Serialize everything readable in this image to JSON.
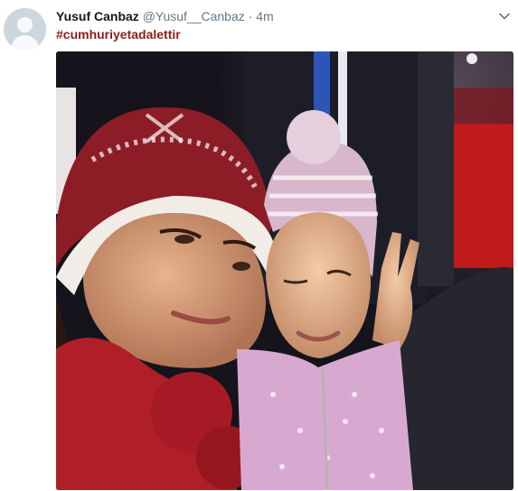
{
  "tweet": {
    "display_name": "Yusuf Canbaz",
    "handle": "@Yusuf__Canbaz",
    "separator": "·",
    "time": "4m",
    "hashtag": "#cumhuriyetadalettir"
  },
  "icons": {
    "avatar": "default-avatar-icon",
    "menu": "chevron-down-icon"
  },
  "colors": {
    "hashtag": "#8b1c1c",
    "secondary_text": "#657786",
    "avatar_bg": "#ccd6dd"
  }
}
